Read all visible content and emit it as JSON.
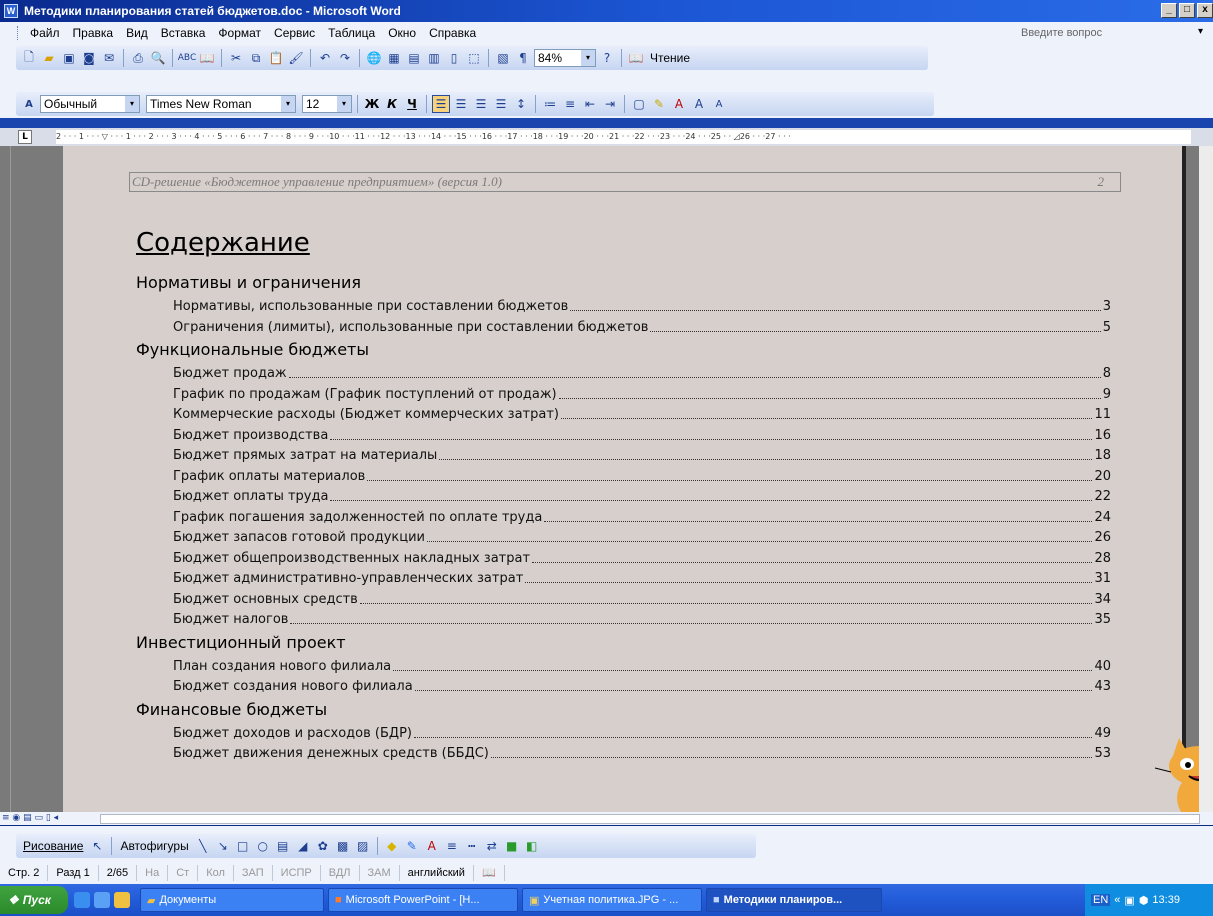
{
  "window": {
    "title": "Методики планирования статей бюджетов.doc - Microsoft Word",
    "app_icon": "W",
    "buttons": [
      "_",
      "□",
      "x"
    ]
  },
  "menu": {
    "items": [
      "Файл",
      "Правка",
      "Вид",
      "Вставка",
      "Формат",
      "Сервис",
      "Таблица",
      "Окно",
      "Справка"
    ],
    "ask_placeholder": "Введите вопрос"
  },
  "standard_toolbar": {
    "zoom": "84%",
    "read_label": "Чтение"
  },
  "format_toolbar": {
    "style": "Обычный",
    "font": "Times New Roman",
    "size": "12",
    "bold": "Ж",
    "italic": "К",
    "underline": "Ч"
  },
  "ruler": {
    "text": "2 · · · 1 · · · ▽ · · · 1 · · · 2 · · · 3 · · · 4 · · · 5 · · · 6 · · · 7 · · · 8 · · · 9 · · ·10 · · ·11 · · ·12 · · ·13 · · ·14 · · ·15 · · ·16 · · ·17 · · ·18 · · ·19 · · ·20 · · ·21 · · ·22 · · ·23 · · ·24 · · ·25 · · ◿26 · · ·27 · · ·"
  },
  "document": {
    "header_text": "CD-решение «Бюджетное управление предприятием» (версия 1.0)",
    "header_page": "2",
    "toc_title": "Содержание",
    "sections": [
      {
        "title": "Нормативы и ограничения",
        "entries": [
          {
            "text": "Нормативы, использованные при составлении бюджетов",
            "page": "3"
          },
          {
            "text": "Ограничения (лимиты), использованные при составлении бюджетов",
            "page": "5"
          }
        ]
      },
      {
        "title": "Функциональные бюджеты",
        "entries": [
          {
            "text": "Бюджет продаж",
            "page": "8"
          },
          {
            "text": "График по продажам (График поступлений от продаж)",
            "page": "9"
          },
          {
            "text": "Коммерческие расходы (Бюджет коммерческих затрат)",
            "page": "11"
          },
          {
            "text": "Бюджет производства",
            "page": "16"
          },
          {
            "text": "Бюджет прямых затрат на материалы",
            "page": "18"
          },
          {
            "text": "График оплаты материалов",
            "page": "20"
          },
          {
            "text": "Бюджет оплаты труда",
            "page": "22"
          },
          {
            "text": "График погашения задолженностей по оплате труда",
            "page": "24"
          },
          {
            "text": "Бюджет запасов готовой продукции",
            "page": "26"
          },
          {
            "text": "Бюджет общепроизводственных накладных затрат",
            "page": "28"
          },
          {
            "text": "Бюджет административно-управленческих затрат",
            "page": "31"
          },
          {
            "text": "Бюджет основных средств",
            "page": "34"
          },
          {
            "text": "Бюджет налогов",
            "page": "35"
          }
        ]
      },
      {
        "title": "Инвестиционный проект",
        "entries": [
          {
            "text": "План создания нового филиала",
            "page": "40"
          },
          {
            "text": "Бюджет создания нового филиала",
            "page": "43"
          }
        ]
      },
      {
        "title": "Финансовые бюджеты",
        "entries": [
          {
            "text": "Бюджет доходов и расходов (БДР)",
            "page": "49"
          },
          {
            "text": "Бюджет движения денежных средств (ББДС)",
            "page": "53"
          }
        ]
      }
    ]
  },
  "drawing_toolbar": {
    "draw_label": "Рисование",
    "autoshapes_label": "Автофигуры"
  },
  "status_bar": {
    "page": "Стр. 2",
    "section": "Разд 1",
    "pages": "2/65",
    "at": "На",
    "line": "Ст",
    "col": "Кол",
    "rec": "ЗАП",
    "trk": "ИСПР",
    "ext": "ВДЛ",
    "ovr": "ЗАМ",
    "language": "английский"
  },
  "taskbar": {
    "start_label": "Пуск",
    "tasks": [
      {
        "label": "Документы"
      },
      {
        "label": "Microsoft PowerPoint - [Н..."
      },
      {
        "label": "Учетная политика.JPG - ..."
      },
      {
        "label": "Методики планиров..."
      }
    ],
    "lang": "EN",
    "clock": "13:39"
  },
  "colors": {
    "page_bg": "#d6cfcc",
    "title_bar": "#1c56d4",
    "taskbar": "#245edb",
    "start": "#2b8a2b"
  }
}
